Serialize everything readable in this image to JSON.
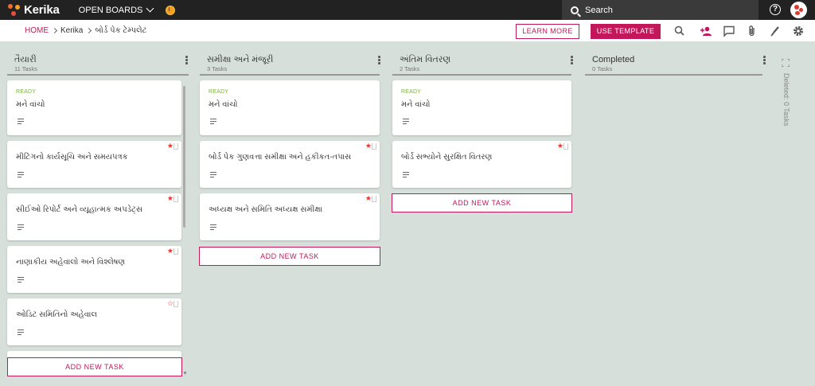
{
  "topbar": {
    "logo": "Kerika",
    "open_boards": "OPEN BOARDS",
    "search_placeholder": "Search"
  },
  "breadcrumb": {
    "home": "HOME",
    "account": "Kerika",
    "board": "બોર્ડ પેક ટેમ્પલેટ"
  },
  "toolbar": {
    "learn_more": "LEARN MORE",
    "use_template": "USE TEMPLATE",
    "icons": [
      "search-icon",
      "add-person-icon",
      "chat-icon",
      "attach-icon",
      "brush-icon",
      "gear-icon"
    ]
  },
  "colors": {
    "accent": "#c2185b",
    "ready": "#7cb342",
    "priority": "#e53935",
    "background": "#d7dfdb"
  },
  "columns": [
    {
      "title": "તૈયારી",
      "count": "11 Tasks",
      "add_label": "ADD NEW TASK",
      "cards": [
        {
          "status": "READY",
          "title": "મને વાંચો",
          "priority": ""
        },
        {
          "status": "",
          "title": "મીટિંગનો કાર્યસૂચિ અને સમયપત્રક",
          "priority": "high"
        },
        {
          "status": "",
          "title": "સીઈઓ રિપોર્ટ અને વ્યૂહાત્મક અપડેટ્સ",
          "priority": "high"
        },
        {
          "status": "",
          "title": "નાણાકીય અહેવાલો અને વિશ્લેષણ",
          "priority": "high"
        },
        {
          "status": "",
          "title": "ઓડિટ સમિતિનો અહેવાલ",
          "priority": "low"
        }
      ]
    },
    {
      "title": "સમીક્ષા અને મંજૂરી",
      "count": "3 Tasks",
      "add_label": "ADD NEW TASK",
      "cards": [
        {
          "status": "READY",
          "title": "મને વાંચો",
          "priority": ""
        },
        {
          "status": "",
          "title": "બોર્ડ પેક ગુણવત્તા સમીક્ષા અને હકીકત-તપાસ",
          "priority": "high"
        },
        {
          "status": "",
          "title": "અધ્યક્ષ અને સમિતિ અધ્યક્ષ સમીક્ષા",
          "priority": "high"
        }
      ]
    },
    {
      "title": "અંતિમ વિતરણ",
      "count": "2 Tasks",
      "add_label": "ADD NEW TASK",
      "cards": [
        {
          "status": "READY",
          "title": "મને વાંચો",
          "priority": ""
        },
        {
          "status": "",
          "title": "બોર્ડ સભ્યોને સુરક્ષિત વિતરણ",
          "priority": "high"
        }
      ]
    },
    {
      "title": "Completed",
      "count": "0 Tasks",
      "cards": []
    }
  ],
  "deleted_label": "Deleted: 0 Tasks"
}
